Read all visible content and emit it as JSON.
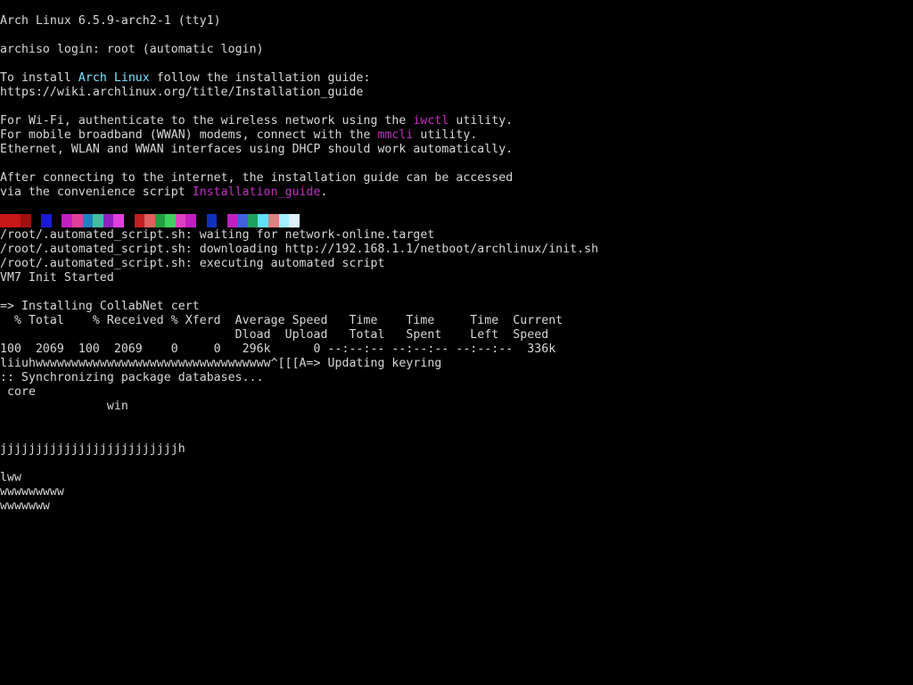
{
  "terminal": {
    "background": "#000000",
    "foreground": "#d8d8d8",
    "accent_cyan": "#7fe3ff",
    "accent_magenta": "#c032c0",
    "lines": [
      [
        {
          "t": "Arch Linux 6.5.9-arch2-1 (tty1)"
        }
      ],
      [],
      [
        {
          "t": "archiso login: root (automatic login)"
        }
      ],
      [],
      [
        {
          "t": "To install "
        },
        {
          "t": "Arch Linux",
          "c": "cyan"
        },
        {
          "t": " follow the installation guide:"
        }
      ],
      [
        {
          "t": "https://wiki.archlinux.org/title/Installation_guide"
        }
      ],
      [],
      [
        {
          "t": "For Wi-Fi, authenticate to the wireless network using the "
        },
        {
          "t": "iwctl",
          "c": "magenta"
        },
        {
          "t": " utility."
        }
      ],
      [
        {
          "t": "For mobile broadband (WWAN) modems, connect with the "
        },
        {
          "t": "mmcli",
          "c": "magenta"
        },
        {
          "t": " utility."
        }
      ],
      [
        {
          "t": "Ethernet, WLAN and WWAN interfaces using DHCP should work automatically."
        }
      ],
      [],
      [
        {
          "t": "After connecting to the internet, the installation guide can be accessed"
        }
      ],
      [
        {
          "t": "via the convenience script "
        },
        {
          "t": "Installation_guide",
          "c": "magenta"
        },
        {
          "t": "."
        }
      ],
      [],
      [],
      [
        {
          "t": "/root/.automated_script.sh: waiting for network-online.target"
        }
      ],
      [
        {
          "t": "/root/.automated_script.sh: downloading http://192.168.1.1/netboot/archlinux/init.sh"
        }
      ],
      [
        {
          "t": "/root/.automated_script.sh: executing automated script"
        }
      ],
      [
        {
          "t": "VM7 Init Started"
        }
      ],
      [],
      [
        {
          "t": "=> Installing CollabNet cert"
        }
      ],
      [
        {
          "t": "  % Total    % Received % Xferd  Average Speed   Time    Time     Time  Current"
        }
      ],
      [
        {
          "t": "                                 Dload  Upload   Total   Spent    Left  Speed"
        }
      ],
      [
        {
          "t": "100  2069  100  2069    0     0   296k      0 --:--:-- --:--:-- --:--:--  336k"
        }
      ],
      [
        {
          "t": "liiuhwwwwwwwwwwwwwwwwwwwwwwwwwwwwwwwww^[[[A=> Updating keyring"
        }
      ],
      [
        {
          "t": ":: Synchronizing package databases..."
        }
      ],
      [
        {
          "t": " core"
        }
      ],
      [
        {
          "t": "               win"
        }
      ],
      [],
      [],
      [
        {
          "t": "jjjjjjjjjjjjjjjjjjjjjjjjjh"
        }
      ],
      [],
      [
        {
          "t": "lww"
        }
      ],
      [
        {
          "t": "wwwwwwwww"
        }
      ],
      [
        {
          "t": "wwwwwww"
        }
      ]
    ],
    "glitch_colors": [
      "#c81818",
      "#c81818",
      "#a01010",
      "#000000",
      "#1a1ad0",
      "#000000",
      "#c020c0",
      "#e0409a",
      "#2080c0",
      "#40c0a0",
      "#9020c0",
      "#e040e0",
      "#000000",
      "#c02020",
      "#e06060",
      "#20a040",
      "#40d060",
      "#e040c0",
      "#c020c0",
      "#000000",
      "#1030c0",
      "#000000",
      "#c020c0",
      "#4060e0",
      "#20a060",
      "#60e0ff",
      "#e08080",
      "#a0f0ff",
      "#e0f0ff"
    ]
  }
}
